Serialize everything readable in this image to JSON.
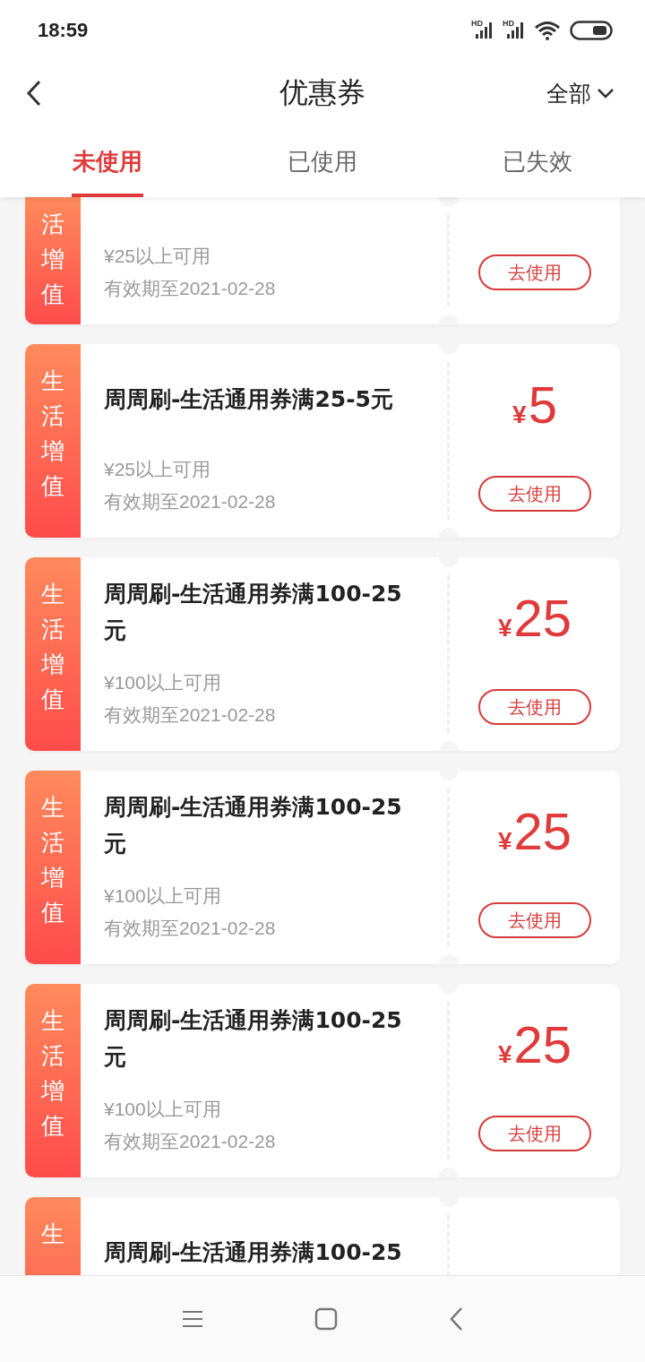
{
  "status_bar": {
    "time": "18:59",
    "signals": [
      {
        "label": "HD"
      },
      {
        "label": "HD"
      }
    ]
  },
  "header": {
    "title": "优惠券",
    "filter": "全部"
  },
  "tabs": [
    {
      "label": "未使用",
      "selected": true
    },
    {
      "label": "已使用",
      "selected": false
    },
    {
      "label": "已失效",
      "selected": false
    }
  ],
  "coupons": [
    {
      "kind": "top-cut",
      "tag": "活增值",
      "condition": "¥25以上可用",
      "expiry": "有效期至2021-02-28",
      "action": "去使用"
    },
    {
      "kind": "full",
      "tag": "生活增值",
      "title": "周周刷-生活通用券满25-5元",
      "amount_symbol": "¥",
      "amount": "5",
      "condition": "¥25以上可用",
      "expiry": "有效期至2021-02-28",
      "action": "去使用"
    },
    {
      "kind": "full",
      "tag": "生活增值",
      "title": "周周刷-生活通用券满100-25元",
      "amount_symbol": "¥",
      "amount": "25",
      "condition": "¥100以上可用",
      "expiry": "有效期至2021-02-28",
      "action": "去使用"
    },
    {
      "kind": "full",
      "tag": "生活增值",
      "title": "周周刷-生活通用券满100-25元",
      "amount_symbol": "¥",
      "amount": "25",
      "condition": "¥100以上可用",
      "expiry": "有效期至2021-02-28",
      "action": "去使用"
    },
    {
      "kind": "full",
      "tag": "生活增值",
      "title": "周周刷-生活通用券满100-25元",
      "amount_symbol": "¥",
      "amount": "25",
      "condition": "¥100以上可用",
      "expiry": "有效期至2021-02-28",
      "action": "去使用"
    },
    {
      "kind": "bottom-cut",
      "tag": "生",
      "title": "周周刷-生活通用券满100-25"
    }
  ]
}
